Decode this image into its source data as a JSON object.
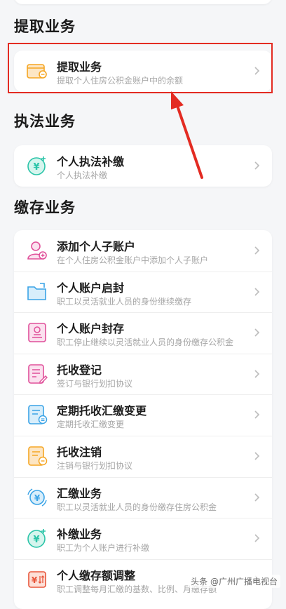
{
  "sections": [
    {
      "title": "提取业务",
      "items": [
        {
          "title": "提取业务",
          "subtitle": "提取个人住房公积金账户中的余额",
          "icon": "card-withdraw-icon"
        }
      ]
    },
    {
      "title": "执法业务",
      "items": [
        {
          "title": "个人执法补缴",
          "subtitle": "个人执法补缴",
          "icon": "yen-plus-icon"
        }
      ]
    },
    {
      "title": "缴存业务",
      "items": [
        {
          "title": "添加个人子账户",
          "subtitle": "在个人住房公积金账户中添加个人子账户",
          "icon": "add-user-icon"
        },
        {
          "title": "个人账户启封",
          "subtitle": "职工以灵活就业人员的身份继续缴存",
          "icon": "folder-open-icon"
        },
        {
          "title": "个人账户封存",
          "subtitle": "职工停止继续以灵活就业人员的身份缴存公积金",
          "icon": "person-seal-icon"
        },
        {
          "title": "托收登记",
          "subtitle": "签订与银行划扣协议",
          "icon": "document-edit-icon"
        },
        {
          "title": "定期托收汇缴变更",
          "subtitle": "定期托收汇缴变更",
          "icon": "document-change-icon"
        },
        {
          "title": "托收注销",
          "subtitle": "注销与银行划扣协议",
          "icon": "document-cancel-icon"
        },
        {
          "title": "汇缴业务",
          "subtitle": "职工以灵活就业人员的身份缴存住房公积金",
          "icon": "yen-cycle-icon"
        },
        {
          "title": "补缴业务",
          "subtitle": "职工为个人账户进行补缴",
          "icon": "yen-plus-icon"
        },
        {
          "title": "个人缴存额调整",
          "subtitle": "职工调整每月汇缴的基数、比例、月缴存额",
          "icon": "yen-adjust-icon"
        }
      ]
    }
  ],
  "watermark": "头条 @广州广播电视台",
  "colors": {
    "highlight": "#e32b22",
    "orange": "#f5a623",
    "teal": "#2bc4a8",
    "pink": "#e0509a",
    "blue": "#3aa3e6"
  }
}
